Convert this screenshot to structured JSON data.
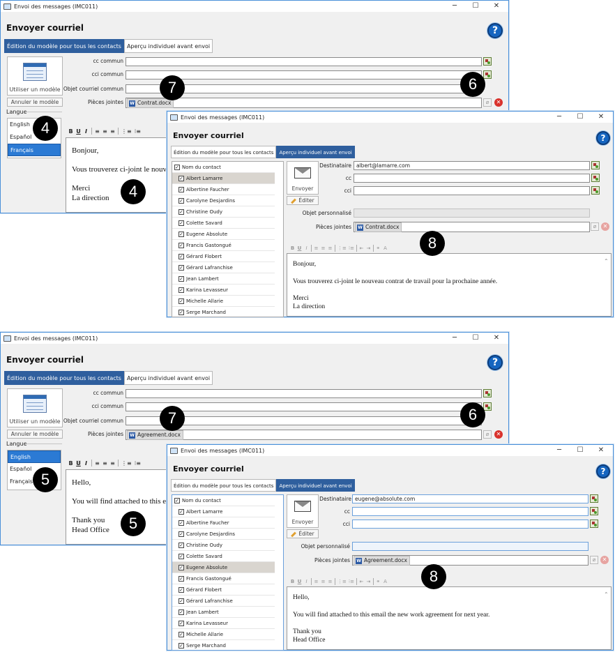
{
  "window": {
    "title": "Envoi des messages (IMC011)",
    "header": "Envoyer courriel",
    "help_label": "?",
    "minimize": "─",
    "maximize": "☐",
    "close": "✕"
  },
  "tabs": {
    "template": "Édition du modèle pour tous les contacts",
    "preview": "Aperçu individuel avant envoi"
  },
  "template_panel": {
    "use_template": "Utiliser un modèle",
    "cancel_template": "Annuler le modèle",
    "language_label": "Langue",
    "languages": [
      "English",
      "Español",
      "Français"
    ]
  },
  "labels": {
    "cc_common": "cc commun",
    "bcc_common": "cci commun",
    "subject_common": "Objet courriel commun",
    "attachments": "Pièces jointes",
    "recipient": "Destinataire",
    "cc": "cc",
    "bcc": "cci",
    "personal_subject": "Objet personnalisé",
    "send": "Envoyer",
    "edit": "Éditer",
    "contact_name_header": "Nom du contact"
  },
  "toolbar": {
    "bold": "B",
    "underline": "U",
    "italic": "I",
    "align_left": "≡",
    "align_center": "≡",
    "align_right": "≡",
    "numbered": "⋮≡",
    "bulleted": "⁝≡",
    "outdent": "⇤",
    "indent": "⇥",
    "link": "⚭",
    "clear": "A"
  },
  "contacts": [
    "Albert Lamarre",
    "Albertine Faucher",
    "Carolyne Desjardins",
    "Christine Oudy",
    "Colette Savard",
    "Eugene Absolute",
    "Francis Gastongué",
    "Gérard Flobert",
    "Gérard Lafranchise",
    "Jean Lambert",
    "Karina Levasseur",
    "Michelle Allarie",
    "Serge Marchand"
  ],
  "example_fr": {
    "selected_language": "Français",
    "attachment": "Contrat.docx",
    "template_body": [
      "Bonjour,",
      "Vous trouverez ci-joint le nouve",
      "Merci",
      "La direction"
    ],
    "preview_recipient": "albert@lamarre.com",
    "preview_selected_contact": "Albert Lamarre",
    "preview_body": [
      "Bonjour,",
      "Vous trouverez ci-joint le nouveau contrat de travail pour la prochaine année.",
      "Merci",
      "La direction"
    ]
  },
  "example_en": {
    "selected_language": "English",
    "attachment": "Agreement.docx",
    "template_body": [
      "Hello,",
      "You will find attached to this em",
      "Thank you",
      "Head Office"
    ],
    "preview_recipient": "eugene@absolute.com",
    "preview_selected_contact": "Eugene Absolute",
    "preview_body": [
      "Hello,",
      "You will find attached to this email the new work agreement for next year.",
      "Thank you",
      "Head Office"
    ]
  },
  "callouts": {
    "language_fr": "4",
    "body_fr": "4",
    "language_en": "5",
    "body_en": "5",
    "addresses": "6",
    "subject": "7",
    "preview": "8"
  }
}
